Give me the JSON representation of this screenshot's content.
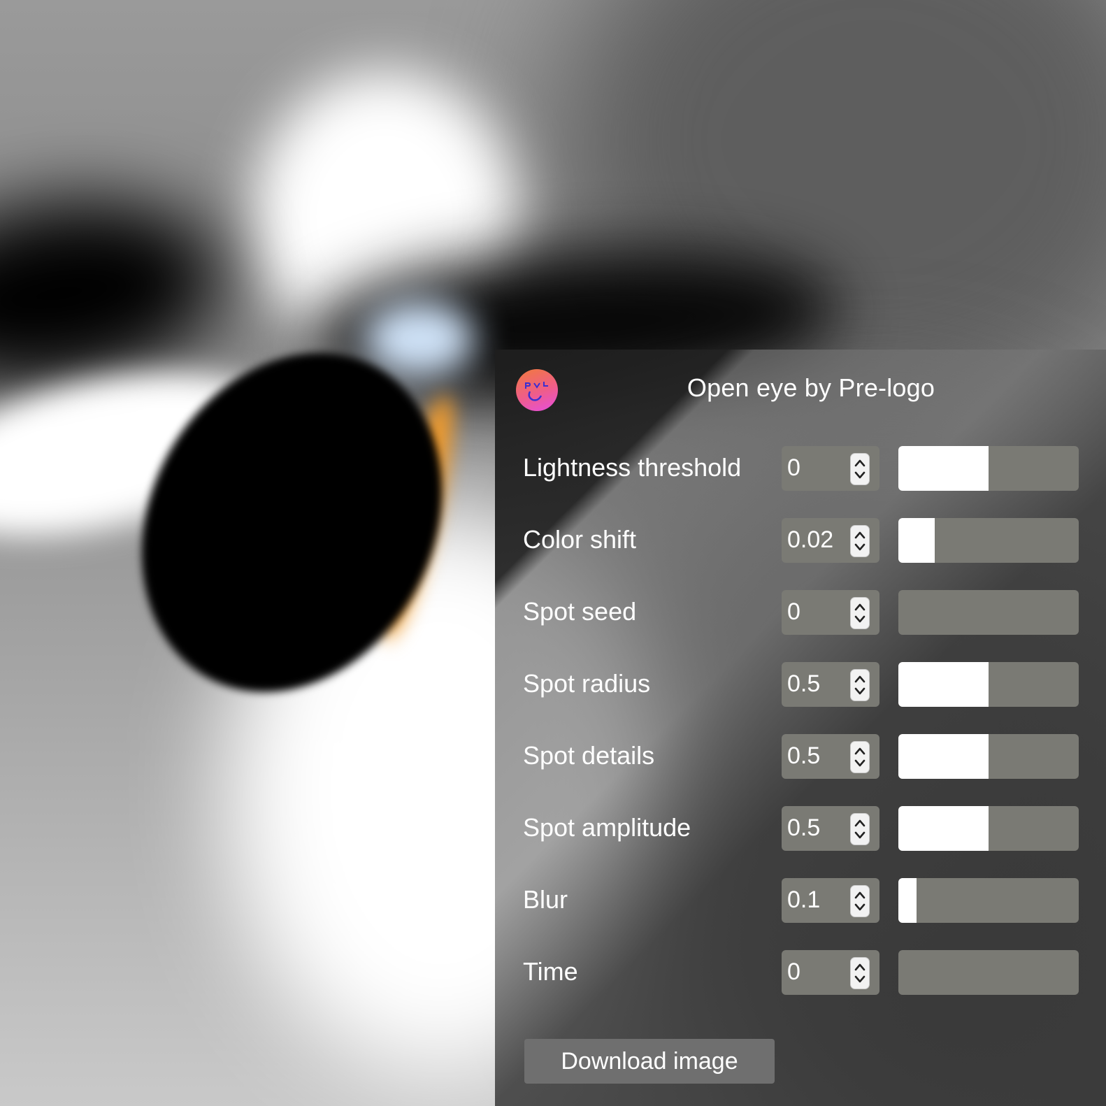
{
  "panel": {
    "title": "Open eye by Pre-logo",
    "logo_icon": "pre-logo-face-icon",
    "download_label": "Download image"
  },
  "controls": [
    {
      "label": "Lightness threshold",
      "value": "0",
      "slider_fraction": 0.5
    },
    {
      "label": "Color shift",
      "value": "0.02",
      "slider_fraction": 0.2
    },
    {
      "label": "Spot seed",
      "value": "0",
      "slider_fraction": 0
    },
    {
      "label": "Spot radius",
      "value": "0.5",
      "slider_fraction": 0.5
    },
    {
      "label": "Spot details",
      "value": "0.5",
      "slider_fraction": 0.5
    },
    {
      "label": "Spot amplitude",
      "value": "0.5",
      "slider_fraction": 0.5
    },
    {
      "label": "Blur",
      "value": "0.1",
      "slider_fraction": 0.1
    },
    {
      "label": "Time",
      "value": "0",
      "slider_fraction": 0
    }
  ],
  "colors": {
    "panel_dark": "#232323",
    "field_bg": "#7a7a74",
    "slider_fill": "#ffffff",
    "logo_gradient": [
      "#f07a3c",
      "#ef5d8a",
      "#e64ee0"
    ]
  }
}
